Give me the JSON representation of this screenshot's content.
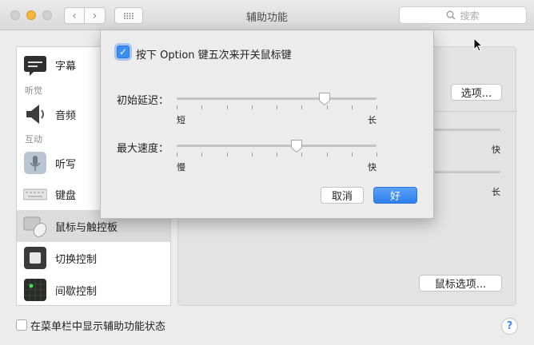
{
  "window": {
    "title": "辅助功能",
    "search_placeholder": "搜索"
  },
  "sidebar": {
    "sections": {
      "hearing": "听觉",
      "interaction": "互动"
    },
    "items": [
      {
        "label": "字幕",
        "icon": "captions-icon"
      },
      {
        "label": "音频",
        "icon": "speaker-icon"
      },
      {
        "label": "听写",
        "icon": "microphone-icon"
      },
      {
        "label": "键盘",
        "icon": "keyboard-icon"
      },
      {
        "label": "鼠标与触控板",
        "icon": "mouse-icon"
      },
      {
        "label": "切换控制",
        "icon": "switch-control-icon"
      },
      {
        "label": "间歇控制",
        "icon": "dwell-control-icon"
      }
    ],
    "selected": "鼠标与触控板"
  },
  "panel": {
    "options_button": "选项...",
    "mouse_options_button": "鼠标选项...",
    "slider_label_fast": "快",
    "slider_label_long": "长"
  },
  "footer": {
    "show_status_label": "在菜单栏中显示辅助功能状态",
    "show_status_checked": false,
    "help": "?"
  },
  "sheet": {
    "enable_label": "按下 Option 键五次来开关鼠标键",
    "enable_checked": true,
    "initial_delay": {
      "label": "初始延迟：",
      "min_label": "短",
      "max_label": "长",
      "value": 0.74
    },
    "max_speed": {
      "label": "最大速度：",
      "min_label": "慢",
      "max_label": "快",
      "value": 0.6
    },
    "cancel": "取消",
    "ok": "好"
  },
  "colors": {
    "accent": "#3b8ef3",
    "minimize": "#f5b63b"
  }
}
